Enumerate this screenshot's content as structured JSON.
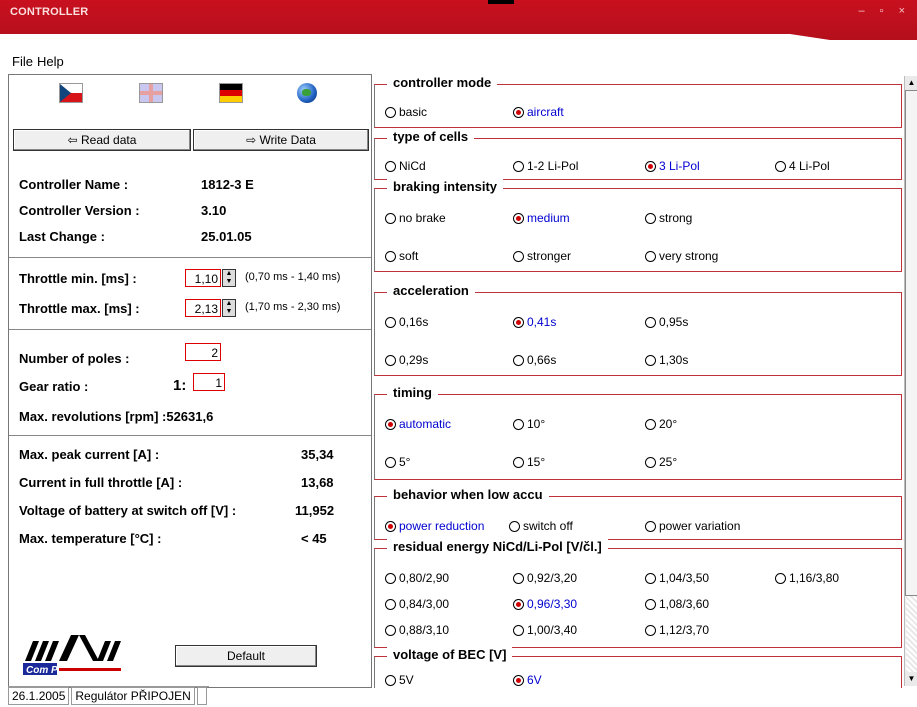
{
  "window": {
    "title": "CONTROLLER",
    "controls": "– ▫ ×"
  },
  "menu": [
    "File",
    "Help"
  ],
  "flags": [
    {
      "name": "czech-flag-icon"
    },
    {
      "name": "uk-flag-icon"
    },
    {
      "name": "german-flag-icon"
    },
    {
      "name": "globe-icon"
    }
  ],
  "buttons": {
    "read": "Read data",
    "write": "Write Data",
    "default": "Default"
  },
  "info": {
    "name_label": "Controller Name :",
    "name_value": "1812-3 E",
    "version_label": "Controller Version :",
    "version_value": "3.10",
    "change_label": "Last Change :",
    "change_value": "25.01.05"
  },
  "throttle": {
    "min_label": "Throttle min. [ms] :",
    "min_value": "1,10",
    "min_range": "(0,70 ms - 1,40 ms)",
    "max_label": "Throttle max. [ms] :",
    "max_value": "2,13",
    "max_range": "(1,70 ms - 2,30 ms)"
  },
  "motor": {
    "poles_label": "Number of poles :",
    "poles_value": "2",
    "gear_label": "Gear ratio :",
    "gear_prefix": "1:",
    "gear_value": "1",
    "rev_label": "Max. revolutions [rpm] :52631,6"
  },
  "stats": {
    "peak_label": "Max. peak current [A] :",
    "peak_value": "35,34",
    "full_label": "Current in full throttle [A] :",
    "full_value": "13,68",
    "volt_label": "Voltage of battery at switch off [V] :",
    "volt_value": "11,952",
    "temp_label": "Max. temperature [°C] :",
    "temp_value": "< 45"
  },
  "logo": {
    "text": "Com Pro"
  },
  "status": {
    "date": "26.1.2005",
    "state": "Regulátor PŘIPOJEN"
  },
  "groups": {
    "mode": {
      "title": "controller mode",
      "options": [
        "basic",
        "aircraft"
      ],
      "selected": 1
    },
    "cells": {
      "title": "type of cells",
      "options": [
        "NiCd",
        "1-2 Li-Pol",
        "3 Li-Pol",
        "4 Li-Pol"
      ],
      "selected": 2
    },
    "braking": {
      "title": "braking intensity",
      "options": [
        "no brake",
        "medium",
        "strong",
        "soft",
        "stronger",
        "very strong"
      ],
      "selected": 1
    },
    "accel": {
      "title": "acceleration",
      "options": [
        "0,16s",
        "0,41s",
        "0,95s",
        "0,29s",
        "0,66s",
        "1,30s"
      ],
      "selected": 1
    },
    "timing": {
      "title": "timing",
      "options": [
        "automatic",
        "10°",
        "20°",
        "5°",
        "15°",
        "25°"
      ],
      "selected": 0
    },
    "lowaccu": {
      "title": "behavior when low accu",
      "options": [
        "power reduction",
        "switch off",
        "power variation"
      ],
      "selected": 0
    },
    "residual": {
      "title": "residual energy NiCd/Li-Pol [V/čl.]",
      "options": [
        "0,80/2,90",
        "0,92/3,20",
        "1,04/3,50",
        "1,16/3,80",
        "0,84/3,00",
        "0,96/3,30",
        "1,08/3,60",
        "0,88/3,10",
        "1,00/3,40",
        "1,12/3,70"
      ],
      "selected": 5
    },
    "bec": {
      "title": "voltage of BEC [V]",
      "options": [
        "5V",
        "6V"
      ],
      "selected": 1
    }
  }
}
